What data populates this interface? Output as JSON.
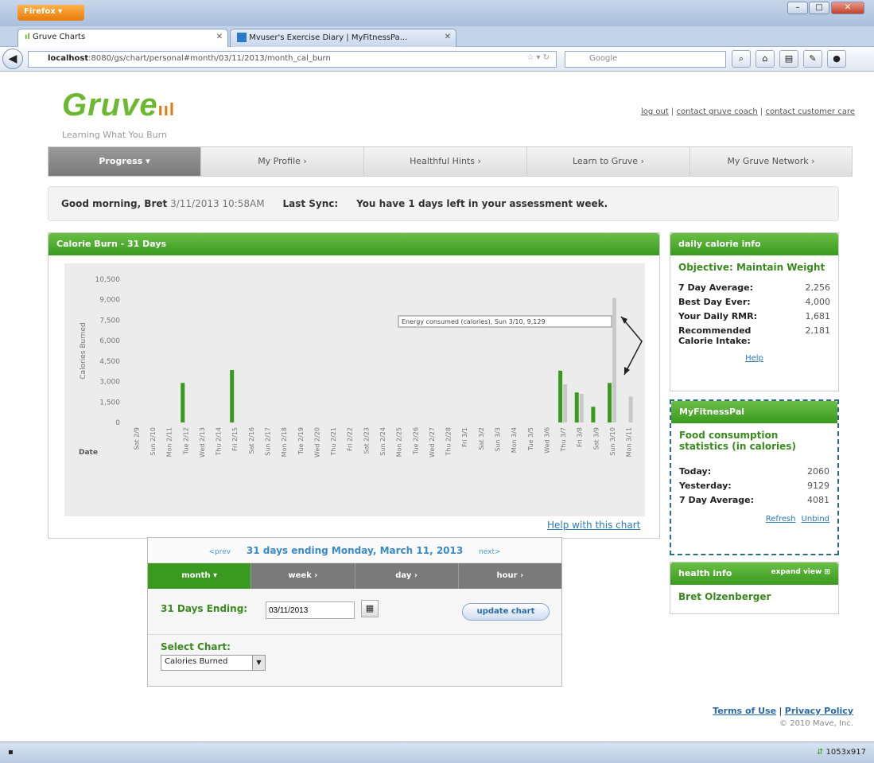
{
  "browser": {
    "menu_button": "Firefox",
    "tabs": [
      {
        "title": "Gruve Charts"
      },
      {
        "title": "Mvuser's Exercise Diary | MyFitnessPa..."
      }
    ],
    "url_host": "localhost",
    "url_path": ":8080/gs/chart/personal#month/03/11/2013/month_cal_burn",
    "search_placeholder": "Google",
    "status_text": "1053x917"
  },
  "site": {
    "logo_text": "Gruve",
    "tagline": "Learning What You Burn",
    "top_links": [
      "log out",
      "contact gruve coach",
      "contact customer care"
    ],
    "nav": [
      "Progress",
      "My Profile",
      "Healthful Hints",
      "Learn to Gruve",
      "My Gruve Network"
    ],
    "greeting": "Good morning, Bret",
    "greeting_time": "3/11/2013 10:58AM",
    "last_sync_label": "Last Sync:",
    "assessment_msg": "You have 1 days left in your assessment week."
  },
  "chart_panel": {
    "title": "Calorie Burn - 31 Days",
    "help_link": "Help with this chart",
    "tooltip": "Energy consumed (calories), Sun 3/10, 9,129"
  },
  "chart_data": {
    "type": "bar",
    "ylabel": "Calories Burned",
    "xlabel": "Date",
    "ylim": [
      0,
      10500
    ],
    "yticks": [
      "10,500",
      "9,000",
      "7,500",
      "6,000",
      "4,500",
      "3,000",
      "1,500",
      "0"
    ],
    "categories": [
      "Sat 2/9",
      "Sun 2/10",
      "Mon 2/11",
      "Tue 2/12",
      "Wed 2/13",
      "Thu 2/14",
      "Fri 2/15",
      "Sat 2/16",
      "Sun 2/17",
      "Mon 2/18",
      "Tue 2/19",
      "Wed 2/20",
      "Thu 2/21",
      "Fri 2/22",
      "Sat 2/23",
      "Sun 2/24",
      "Mon 2/25",
      "Tue 2/26",
      "Wed 2/27",
      "Thu 2/28",
      "Fri 3/1",
      "Sat 3/2",
      "Sun 3/3",
      "Mon 3/4",
      "Tue 3/5",
      "Wed 3/6",
      "Thu 3/7",
      "Fri 3/8",
      "Sat 3/9",
      "Sun 3/10",
      "Mon 3/11"
    ],
    "series": [
      {
        "color": "#3a9a1f",
        "values": [
          0,
          0,
          0,
          2900,
          0,
          0,
          3850,
          0,
          0,
          0,
          0,
          0,
          0,
          0,
          0,
          0,
          0,
          0,
          0,
          0,
          0,
          0,
          0,
          0,
          0,
          0,
          3800,
          2200,
          1150,
          2900,
          0
        ]
      },
      {
        "color": "#c8c8c8",
        "values": [
          0,
          0,
          0,
          0,
          0,
          0,
          0,
          0,
          0,
          0,
          0,
          0,
          0,
          0,
          0,
          0,
          0,
          0,
          0,
          0,
          0,
          0,
          0,
          0,
          0,
          0,
          2800,
          2100,
          0,
          9129,
          1900
        ]
      }
    ]
  },
  "date_form": {
    "prev": "<prev",
    "next": "next>",
    "range_title": "31 days ending Monday, March 11, 2013",
    "tabs": [
      "month",
      "week",
      "day",
      "hour"
    ],
    "ending_label": "31 Days Ending:",
    "ending_value": "03/11/2013",
    "update_button": "update chart",
    "select_label": "Select Chart:",
    "select_value": "Calories Burned"
  },
  "daily_info": {
    "title": "daily calorie info",
    "objective": "Objective: Maintain Weight",
    "rows": [
      {
        "label": "7 Day Average:",
        "value": "2,256"
      },
      {
        "label": "Best Day Ever:",
        "value": "4,000"
      },
      {
        "label": "Your Daily RMR:",
        "value": "1,681"
      },
      {
        "label": "Recommended Calorie Intake:",
        "value": "2,181"
      }
    ],
    "help_link": "Help"
  },
  "mfp": {
    "title": "MyFitnessPal",
    "subtitle": "Food consumption statistics (in calories)",
    "rows": [
      {
        "label": "Today:",
        "value": "2060"
      },
      {
        "label": "Yesterday:",
        "value": "9129"
      },
      {
        "label": "7 Day Average:",
        "value": "4081"
      }
    ],
    "refresh": "Refresh",
    "unbind": "Unbind"
  },
  "health": {
    "title": "health info",
    "expand": "expand view",
    "name": "Bret Olzenberger"
  },
  "footer": {
    "terms": "Terms of Use",
    "privacy": "Privacy Policy",
    "copyright": "© 2010 Mave, Inc."
  },
  "colors": {
    "brand_green": "#3a9a1f",
    "link_blue": "#2a7ab8",
    "accent_orange": "#e07a10"
  }
}
